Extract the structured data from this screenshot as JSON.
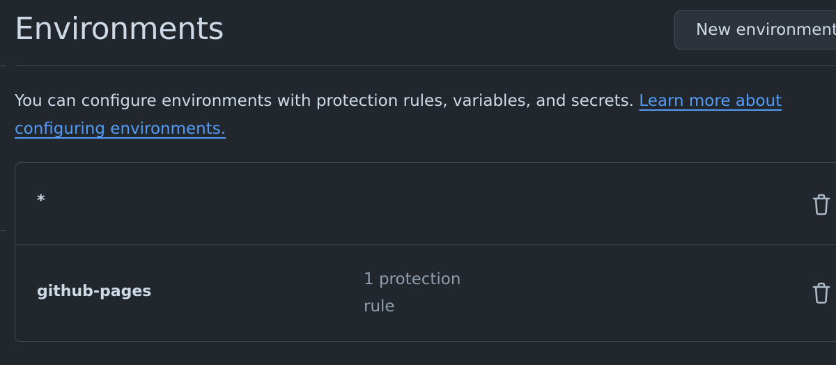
{
  "header": {
    "title": "Environments",
    "new_environment_label": "New environment"
  },
  "description": {
    "text": "You can configure environments with protection rules, variables, and secrets. ",
    "link_text": "Learn more about configuring environments."
  },
  "environments": [
    {
      "name": "*",
      "rules": ""
    },
    {
      "name": "github-pages",
      "rules": "1 protection rule"
    }
  ],
  "icons": {
    "delete": "trash-icon"
  },
  "colors": {
    "background": "#22272e",
    "link": "#539bf5",
    "border": "#444c56",
    "text": "#cdd9e5",
    "muted": "#909dab"
  }
}
